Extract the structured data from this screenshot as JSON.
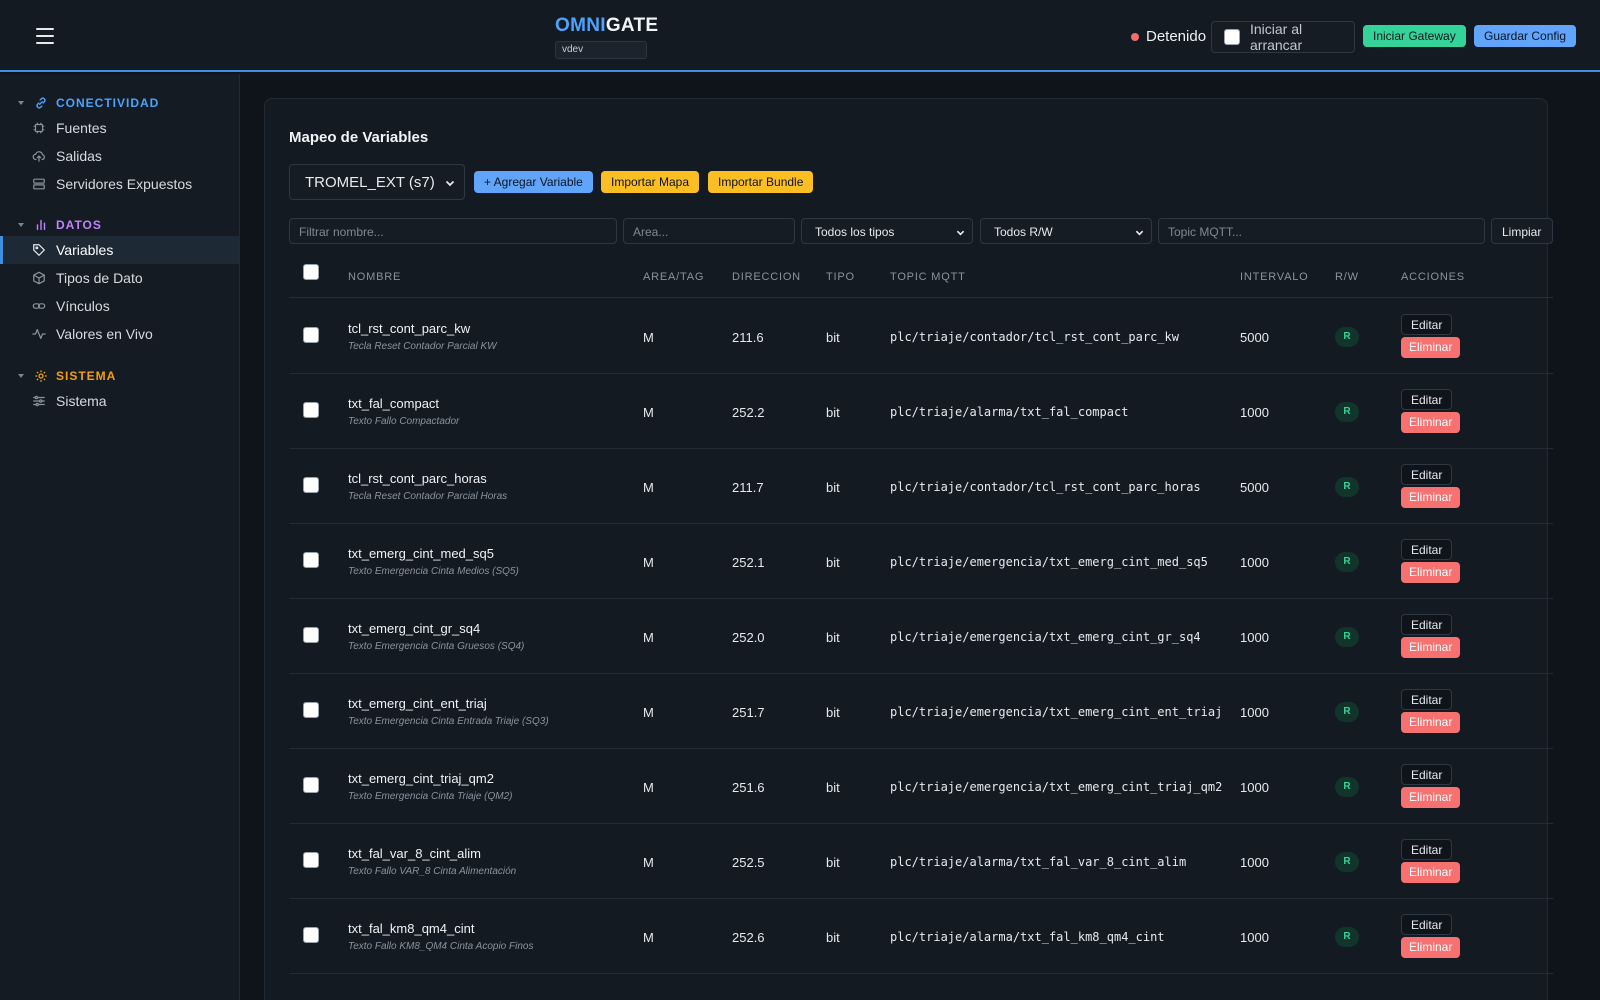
{
  "header": {
    "brand_a": "OMNI",
    "brand_b": "GATE",
    "version": "vdev",
    "status": "Detenido",
    "autostart_label": "Iniciar al arrancar",
    "start_btn": "Iniciar Gateway",
    "save_btn": "Guardar Config"
  },
  "sidebar": {
    "conn_title": "CONECTIVIDAD",
    "fuentes": "Fuentes",
    "salidas": "Salidas",
    "servidores": "Servidores Expuestos",
    "data_title": "DATOS",
    "variables": "Variables",
    "tipos": "Tipos de Dato",
    "vinculos": "Vínculos",
    "valores": "Valores en Vivo",
    "sys_title": "SISTEMA",
    "sistema": "Sistema"
  },
  "main": {
    "title": "Mapeo de Variables",
    "source": "TROMEL_EXT (s7)",
    "add_btn": "+ Agregar Variable",
    "import_map": "Importar Mapa",
    "import_bundle": "Importar Bundle",
    "filter_name_ph": "Filtrar nombre...",
    "filter_area_ph": "Area...",
    "filter_type": "Todos los tipos",
    "filter_rw": "Todos R/W",
    "filter_topic_ph": "Topic MQTT...",
    "clear_btn": "Limpiar",
    "edit_label": "Editar",
    "delete_label": "Eliminar"
  },
  "columns": [
    "NOMBRE",
    "AREA/TAG",
    "DIRECCION",
    "TIPO",
    "TOPIC MQTT",
    "INTERVALO",
    "R/W",
    "ACCIONES"
  ],
  "rows": [
    {
      "name": "tcl_rst_cont_parc_kw",
      "desc": "Tecla Reset Contador Parcial KW",
      "area": "M",
      "addr": "211.6",
      "type": "bit",
      "topic": "plc/triaje/contador/tcl_rst_cont_parc_kw",
      "interval": "5000",
      "rw": "R"
    },
    {
      "name": "txt_fal_compact",
      "desc": "Texto Fallo Compactador",
      "area": "M",
      "addr": "252.2",
      "type": "bit",
      "topic": "plc/triaje/alarma/txt_fal_compact",
      "interval": "1000",
      "rw": "R"
    },
    {
      "name": "tcl_rst_cont_parc_horas",
      "desc": "Tecla Reset Contador Parcial Horas",
      "area": "M",
      "addr": "211.7",
      "type": "bit",
      "topic": "plc/triaje/contador/tcl_rst_cont_parc_horas",
      "interval": "5000",
      "rw": "R"
    },
    {
      "name": "txt_emerg_cint_med_sq5",
      "desc": "Texto Emergencia Cinta Medios (SQ5)",
      "area": "M",
      "addr": "252.1",
      "type": "bit",
      "topic": "plc/triaje/emergencia/txt_emerg_cint_med_sq5",
      "interval": "1000",
      "rw": "R"
    },
    {
      "name": "txt_emerg_cint_gr_sq4",
      "desc": "Texto Emergencia Cinta Gruesos (SQ4)",
      "area": "M",
      "addr": "252.0",
      "type": "bit",
      "topic": "plc/triaje/emergencia/txt_emerg_cint_gr_sq4",
      "interval": "1000",
      "rw": "R"
    },
    {
      "name": "txt_emerg_cint_ent_triaj",
      "desc": "Texto Emergencia Cinta Entrada Triaje (SQ3)",
      "area": "M",
      "addr": "251.7",
      "type": "bit",
      "topic": "plc/triaje/emergencia/txt_emerg_cint_ent_triaj",
      "interval": "1000",
      "rw": "R"
    },
    {
      "name": "txt_emerg_cint_triaj_qm2",
      "desc": "Texto Emergencia Cinta Triaje (QM2)",
      "area": "M",
      "addr": "251.6",
      "type": "bit",
      "topic": "plc/triaje/emergencia/txt_emerg_cint_triaj_qm2",
      "interval": "1000",
      "rw": "R"
    },
    {
      "name": "txt_fal_var_8_cint_alim",
      "desc": "Texto Fallo VAR_8 Cinta Alimentación",
      "area": "M",
      "addr": "252.5",
      "type": "bit",
      "topic": "plc/triaje/alarma/txt_fal_var_8_cint_alim",
      "interval": "1000",
      "rw": "R"
    },
    {
      "name": "txt_fal_km8_qm4_cint",
      "desc": "Texto Fallo KM8_QM4 Cinta Acopio Finos",
      "area": "M",
      "addr": "252.6",
      "type": "bit",
      "topic": "plc/triaje/alarma/txt_fal_km8_qm4_cint",
      "interval": "1000",
      "rw": "R"
    }
  ]
}
